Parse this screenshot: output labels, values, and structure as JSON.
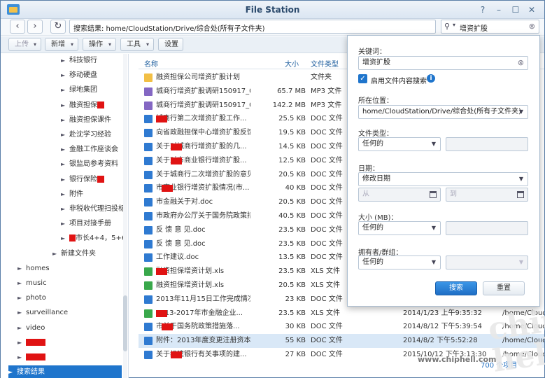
{
  "window": {
    "title": "File Station"
  },
  "navbar": {
    "path": "搜索结果: home/CloudStation/Drive/综合处(所有子文件夹)",
    "search_value": "增资扩股"
  },
  "toolbar": {
    "upload": "上传",
    "new": "新增",
    "action": "操作",
    "tools": "工具",
    "settings": "设置"
  },
  "sidebar": {
    "items": [
      {
        "label": "科技银行",
        "level": 2,
        "redact_after": 0
      },
      {
        "label": "移动硬盘",
        "level": 2,
        "redact_after": 0
      },
      {
        "label": "绿地集团",
        "level": 2,
        "redact_after": 0
      },
      {
        "label": "融资担保",
        "level": 2,
        "redact_after": 1
      },
      {
        "label": "融资担保课件",
        "level": 2,
        "redact_after": 0
      },
      {
        "label": "赴沈学习经验",
        "level": 2,
        "redact_after": 0
      },
      {
        "label": "金融工作座谈会",
        "level": 2,
        "redact_after": 0
      },
      {
        "label": "银监局参考资料",
        "level": 2,
        "redact_after": 0
      },
      {
        "label": "银行保险",
        "level": 2,
        "redact_after": 1
      },
      {
        "label": "附件",
        "level": 2,
        "redact_after": 0
      },
      {
        "label": "非税收代理扫投标",
        "level": 2,
        "redact_after": 0
      },
      {
        "label": "项目对接手册",
        "level": 2,
        "redact_after": 0
      },
      {
        "label": "市长4+4，5+6",
        "level": 2,
        "redact_before": 1
      },
      {
        "label": "新建文件夹",
        "level": 1,
        "redact_after": 0
      },
      {
        "label": "homes",
        "level": 0
      },
      {
        "label": "music",
        "level": 0
      },
      {
        "label": "photo",
        "level": 0
      },
      {
        "label": "surveillance",
        "level": 0
      },
      {
        "label": "video",
        "level": 0
      },
      {
        "label": "",
        "level": 0,
        "redact_only": 1
      },
      {
        "label": "",
        "level": 0,
        "redact_only": 1
      },
      {
        "label": "搜索结果",
        "level": 0,
        "active": 1
      }
    ]
  },
  "filelist": {
    "headers": {
      "name": "名称",
      "size": "大小",
      "type": "文件类型"
    },
    "rows": [
      {
        "icon": "folder",
        "name": "融资担保公司增资扩股计划",
        "size": "",
        "type": "文件夹",
        "date": "",
        "path": ""
      },
      {
        "icon": "mp3",
        "name": "城商行增资扩股调研150917_0...",
        "size": "65.7 MB",
        "type": "MP3 文件",
        "date": "",
        "path": ""
      },
      {
        "icon": "mp3",
        "name": "城商行增资扩股调研150917_0...",
        "size": "142.2 MB",
        "type": "MP3 文件",
        "date": "",
        "path": ""
      },
      {
        "icon": "doc",
        "name": "城商行第二次增资扩股工作...",
        "size": "25.5 KB",
        "type": "DOC 文件",
        "date": "",
        "path": "",
        "redact": 1
      },
      {
        "icon": "doc",
        "name": "向省政融担保中心增资扩股反馈...",
        "size": "19.5 KB",
        "type": "DOC 文件",
        "date": "",
        "path": ""
      },
      {
        "icon": "doc",
        "name": "关于对城商行增资扩股的几...",
        "size": "14.5 KB",
        "type": "DOC 文件",
        "date": "",
        "path": "",
        "redact": 1
      },
      {
        "icon": "doc",
        "name": "关于对市商业银行增资扩股...",
        "size": "12.5 KB",
        "type": "DOC 文件",
        "date": "",
        "path": "",
        "redact": 1
      },
      {
        "icon": "doc",
        "name": "关于城商行二次增资扩股的意见...",
        "size": "20.5 KB",
        "type": "DOC 文件",
        "date": "",
        "path": ""
      },
      {
        "icon": "doc",
        "name": "市商业银行增资扩股情况(市...",
        "size": "40 KB",
        "type": "DOC 文件",
        "date": "",
        "path": "",
        "redact": 1
      },
      {
        "icon": "doc",
        "name": "市金融关于对.doc",
        "size": "20.5 KB",
        "type": "DOC 文件",
        "date": "",
        "path": ""
      },
      {
        "icon": "doc",
        "name": "市政府办公厅关于国务院政策措...",
        "size": "40.5 KB",
        "type": "DOC 文件",
        "date": "",
        "path": ""
      },
      {
        "icon": "doc",
        "name": "反 馈 意 见.doc",
        "size": "23.5 KB",
        "type": "DOC 文件",
        "date": "",
        "path": ""
      },
      {
        "icon": "doc",
        "name": "反 馈 意 见.doc",
        "size": "23.5 KB",
        "type": "DOC 文件",
        "date": "",
        "path": ""
      },
      {
        "icon": "doc",
        "name": "工作建议.doc",
        "size": "13.5 KB",
        "type": "DOC 文件",
        "date": "",
        "path": ""
      },
      {
        "icon": "xls",
        "name": "融资担保增资计划.xls",
        "size": "23.5 KB",
        "type": "XLS 文件",
        "date": "",
        "path": "",
        "redact": 1
      },
      {
        "icon": "xls",
        "name": "融资担保增资计划.xls",
        "size": "20.5 KB",
        "type": "XLS 文件",
        "date": "",
        "path": ""
      },
      {
        "icon": "doc",
        "name": "2013年11月15日工作完成情况...",
        "size": "23 KB",
        "type": "DOC 文件",
        "date": "",
        "path": ""
      },
      {
        "icon": "xls",
        "name": "2013-2017年市金融企业...",
        "size": "23.5 KB",
        "type": "XLS 文件",
        "date": "2014/1/23 上午9:35:32",
        "path": "/home/CloudS...",
        "redact": 1
      },
      {
        "icon": "doc",
        "name": "市关于国务院政策措施落...",
        "size": "30 KB",
        "type": "DOC 文件",
        "date": "2014/8/12 下午5:39:54",
        "path": "/home/Cloud...",
        "redact": 1
      },
      {
        "icon": "doc",
        "name": "附件：2013年度变更注册资本...",
        "size": "55 KB",
        "type": "DOC 文件",
        "date": "2014/8/2 下午5:52:28",
        "path": "/home/Cloud...",
        "sel": 1
      },
      {
        "icon": "doc",
        "name": "关于组建银行有关事项的建...",
        "size": "27 KB",
        "type": "DOC 文件",
        "date": "2015/10/12 下午3:13:30",
        "path": "/home/Cloud...",
        "redact": 1
      }
    ],
    "status": "700 个项目"
  },
  "search_panel": {
    "keyword_label": "关键词：",
    "keyword_value": "增资扩股",
    "content_search_label": "启用文件内容搜索",
    "location_label": "所在位置：",
    "location_value": "home/CloudStation/Drive/综合处(所有子文件夹)",
    "filetype_label": "文件类型：",
    "filetype_value": "任何的",
    "date_label": "日期：",
    "date_value": "修改日期",
    "from_placeholder": "从",
    "to_placeholder": "到",
    "size_label": "大小 (MB)：",
    "size_value": "任何的",
    "owner_label": "拥有者/群组：",
    "owner_value": "任何的",
    "search_button": "搜索",
    "reset_button": "重置"
  },
  "watermark": {
    "small": "www.chiphell.com",
    "big": "chip hell"
  },
  "colors": {
    "accent": "#1f75cc",
    "redaction": "#e01313",
    "folder": "#f2bf45",
    "doc": "#2f7ad1",
    "xls": "#39a84b",
    "mp3": "#8467c3"
  }
}
